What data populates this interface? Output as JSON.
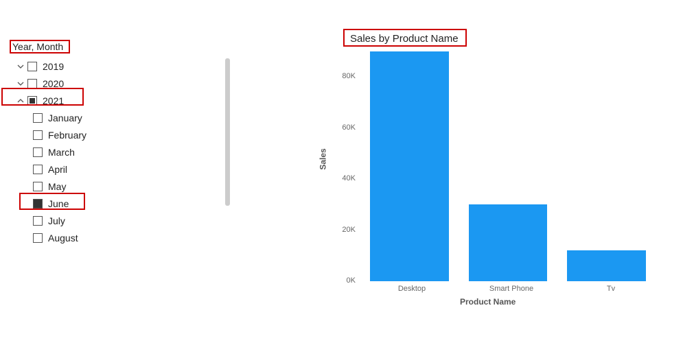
{
  "slicer": {
    "title": "Year, Month",
    "years": [
      {
        "label": "2019",
        "expanded": false,
        "state": "unchecked",
        "months": []
      },
      {
        "label": "2020",
        "expanded": false,
        "state": "unchecked",
        "months": []
      },
      {
        "label": "2021",
        "expanded": true,
        "state": "indeterminate",
        "months": [
          {
            "label": "January",
            "state": "unchecked"
          },
          {
            "label": "February",
            "state": "unchecked"
          },
          {
            "label": "March",
            "state": "unchecked"
          },
          {
            "label": "April",
            "state": "unchecked"
          },
          {
            "label": "May",
            "state": "unchecked"
          },
          {
            "label": "June",
            "state": "checked"
          },
          {
            "label": "July",
            "state": "unchecked"
          },
          {
            "label": "August",
            "state": "unchecked"
          }
        ]
      }
    ]
  },
  "chart_data": {
    "type": "bar",
    "title": "Sales by Product Name",
    "xlabel": "Product Name",
    "ylabel": "Sales",
    "categories": [
      "Desktop",
      "Smart Phone",
      "Tv"
    ],
    "values": [
      90000,
      30000,
      12000
    ],
    "ylim": [
      0,
      90000
    ],
    "yticks": [
      0,
      20000,
      40000,
      60000,
      80000
    ],
    "ytick_labels": [
      "0K",
      "20K",
      "40K",
      "60K",
      "80K"
    ],
    "bar_color": "#1b98f2"
  }
}
